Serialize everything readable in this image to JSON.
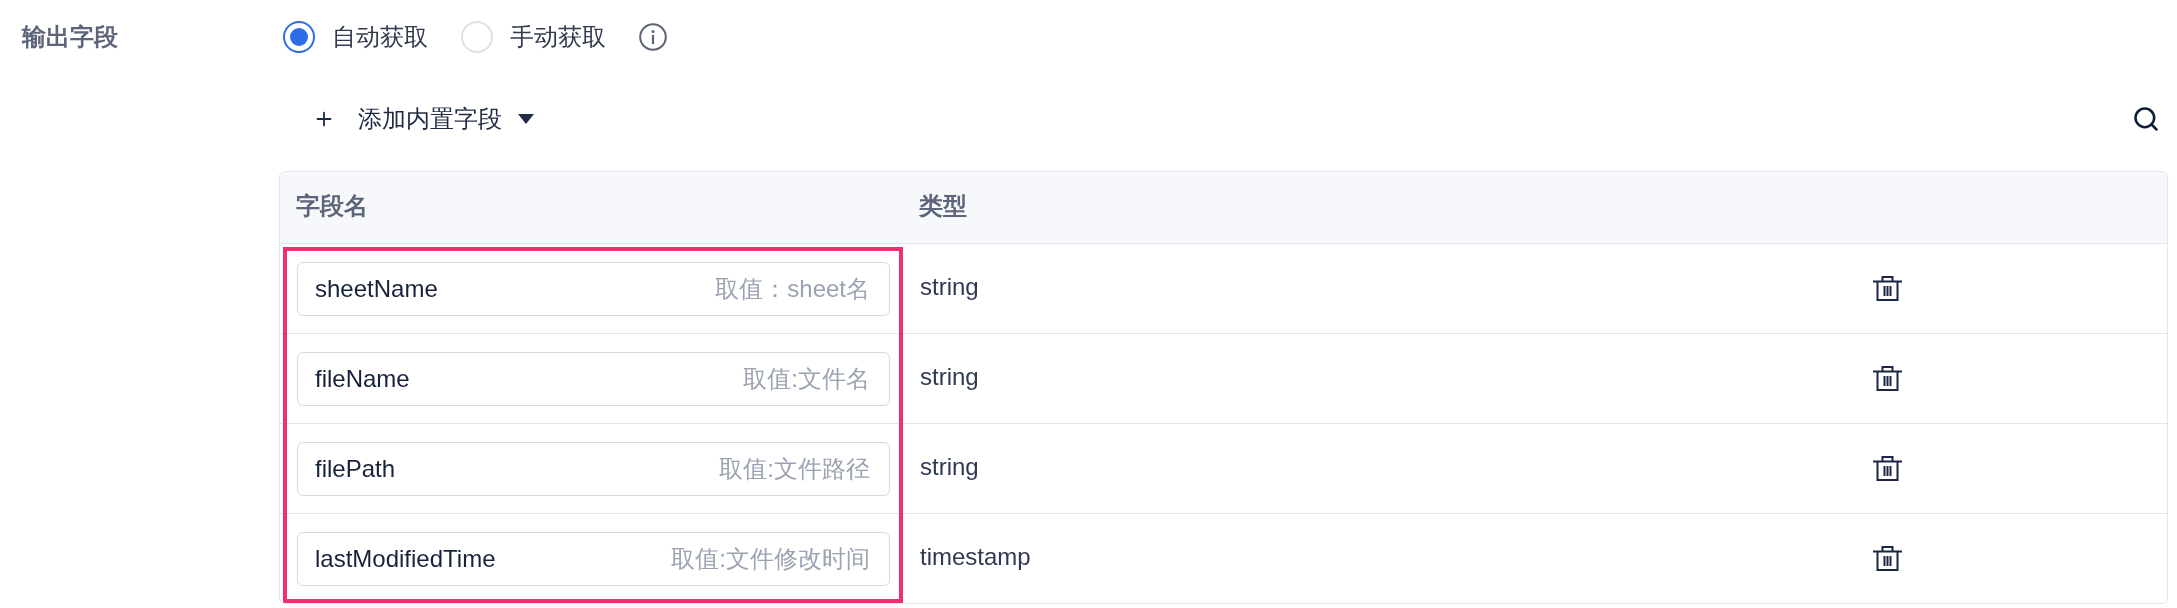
{
  "output_fields": {
    "label": "输出字段",
    "modes": [
      {
        "label": "自动获取",
        "selected": true
      },
      {
        "label": "手动获取",
        "selected": false
      }
    ]
  },
  "toolbar": {
    "add_button": "添加内置字段"
  },
  "table": {
    "columns": [
      {
        "label": "字段名",
        "highlighted": true
      },
      {
        "label": "类型",
        "highlighted": false
      }
    ],
    "rows": [
      {
        "name": "sheetName",
        "hint": "取值：sheet名",
        "type": "string"
      },
      {
        "name": "fileName",
        "hint": "取值:文件名",
        "type": "string"
      },
      {
        "name": "filePath",
        "hint": "取值:文件路径",
        "type": "string"
      },
      {
        "name": "lastModifiedTime",
        "hint": "取值:文件修改时间",
        "type": "timestamp"
      }
    ]
  }
}
